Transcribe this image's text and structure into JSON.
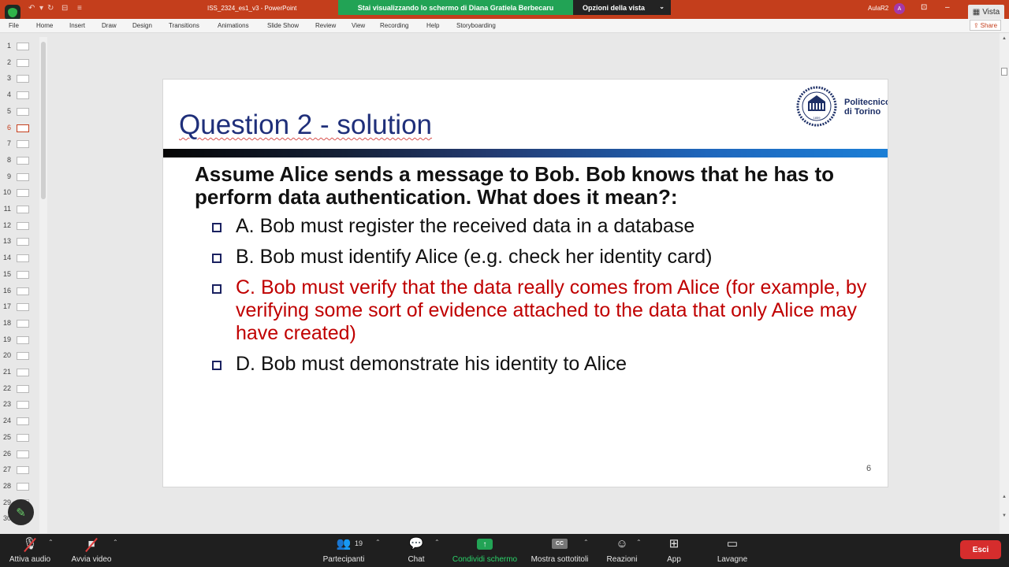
{
  "titlebar": {
    "doc_title": "ISS_2324_es1_v3  -  PowerPoint",
    "share_banner": "Stai visualizzando lo schermo di Diana Gratiela Berbecaru",
    "view_options": "Opzioni della vista",
    "user_name": "AulaR2",
    "avatar_initial": "A",
    "vista_label": "Vista"
  },
  "ribbon": {
    "tabs": [
      "File",
      "Home",
      "Insert",
      "Draw",
      "Design",
      "Transitions",
      "Animations",
      "Slide Show",
      "Review",
      "View",
      "Recording",
      "Help",
      "Storyboarding"
    ],
    "share_label": "Share"
  },
  "slide_panel": {
    "numbers": [
      "1",
      "2",
      "3",
      "4",
      "5",
      "6",
      "7",
      "8",
      "9",
      "10",
      "11",
      "12",
      "13",
      "14",
      "15",
      "16",
      "17",
      "18",
      "19",
      "20",
      "21",
      "22",
      "23",
      "24",
      "25",
      "26",
      "27",
      "28",
      "29",
      "30"
    ],
    "active": "6"
  },
  "slide": {
    "title": "Question 2 - solution",
    "logo_line1": "Politecnico",
    "logo_line2": "di Torino",
    "logo_year": "1859",
    "question": "Assume Alice sends a message to Bob. Bob knows that he has to perform data authentication. What does it mean?:",
    "options": [
      "A. Bob must register the received data in a database",
      "B. Bob must identify Alice (e.g. check her identity card)",
      "C. Bob must verify that the data really comes from Alice (for example, by verifying some sort of evidence attached to the data that only Alice may have created)",
      "D. Bob must demonstrate his identity to Alice"
    ],
    "correct_option": "C",
    "page_number": "6"
  },
  "meeting_bar": {
    "audio": "Attiva audio",
    "video": "Avvia video",
    "participants": "Partecipanti",
    "participants_count": "19",
    "chat": "Chat",
    "share_screen": "Condividi schermo",
    "captions": "Mostra sottotitoli",
    "captions_icon": "CC",
    "reactions": "Reazioni",
    "apps": "App",
    "whiteboards": "Lavagne",
    "exit": "Esci"
  },
  "colors": {
    "ppt_red": "#c43e1c",
    "title_blue": "#1f2f7a",
    "correct_red": "#c00000",
    "share_green": "#22a355",
    "exit_red": "#d62d2d"
  }
}
